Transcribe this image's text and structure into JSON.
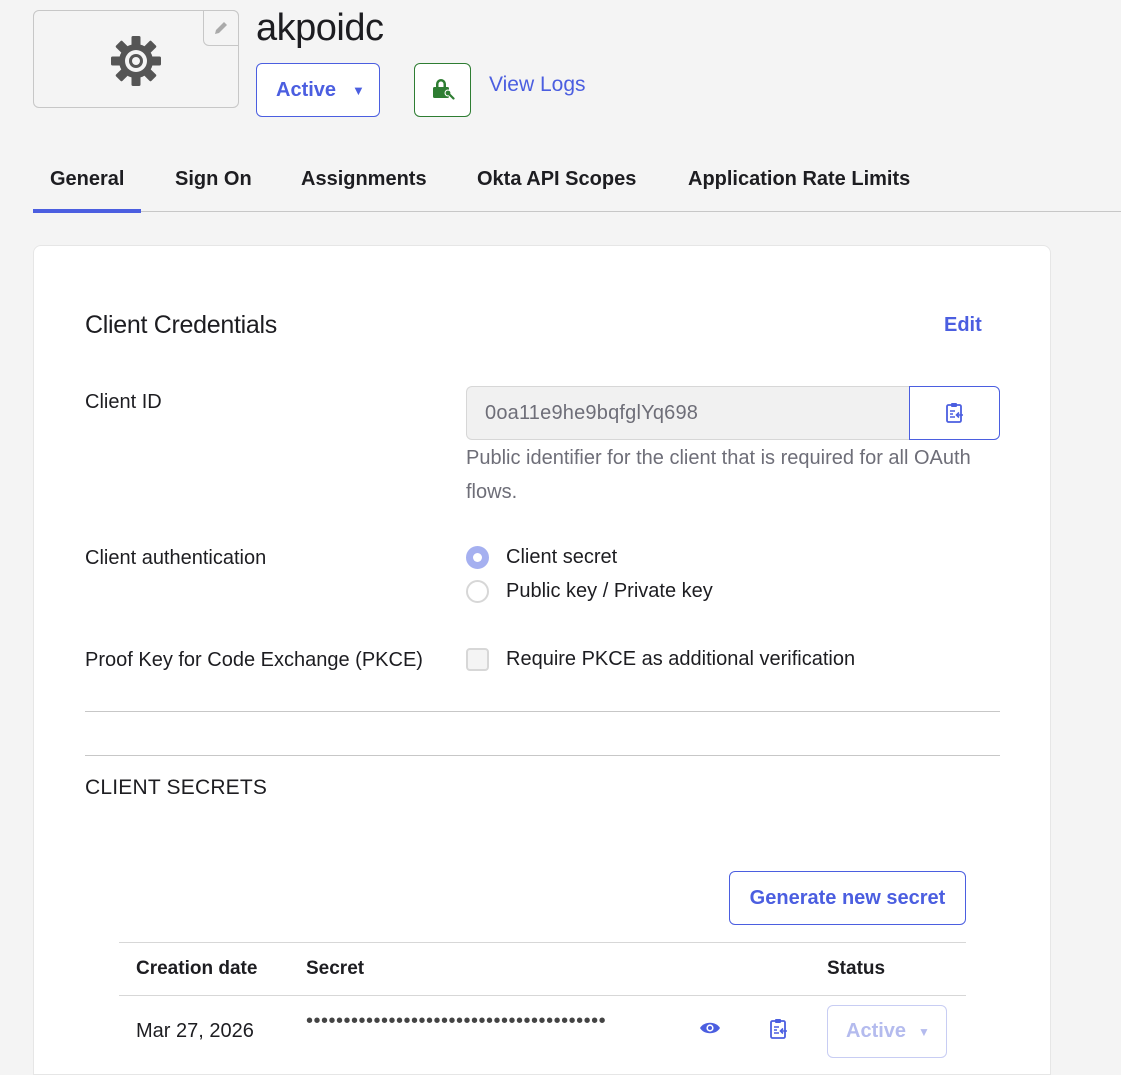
{
  "app": {
    "title": "akpoidc",
    "status_label": "Active",
    "view_logs_label": "View Logs"
  },
  "tabs": [
    {
      "label": "General",
      "active": true
    },
    {
      "label": "Sign On",
      "active": false
    },
    {
      "label": "Assignments",
      "active": false
    },
    {
      "label": "Okta API Scopes",
      "active": false
    },
    {
      "label": "Application Rate Limits",
      "active": false
    }
  ],
  "credentials": {
    "title": "Client Credentials",
    "edit_label": "Edit",
    "client_id_label": "Client ID",
    "client_id_value": "0oa11e9he9bqfglYq698",
    "client_id_help": "Public identifier for the client that is required for all OAuth flows.",
    "auth_label": "Client authentication",
    "auth_options": [
      {
        "label": "Client secret",
        "checked": true
      },
      {
        "label": "Public key / Private key",
        "checked": false
      }
    ],
    "pkce_label": "Proof Key for Code Exchange (PKCE)",
    "pkce_option": {
      "label": "Require PKCE as additional verification",
      "checked": false
    }
  },
  "secrets": {
    "title": "CLIENT SECRETS",
    "generate_label": "Generate new secret",
    "columns": [
      "Creation date",
      "Secret",
      "Status"
    ],
    "rows": [
      {
        "date": "Mar 27, 2026",
        "secret": "••••••••••••••••••••••••••••••••••••••••",
        "status": "Active"
      }
    ]
  },
  "colors": {
    "accent": "#4b5ee0",
    "push_green": "#2e7d32"
  },
  "icons": [
    "gear-icon",
    "pencil-icon",
    "lock-key-icon",
    "clipboard-icon",
    "eye-icon",
    "caret-down-icon"
  ]
}
